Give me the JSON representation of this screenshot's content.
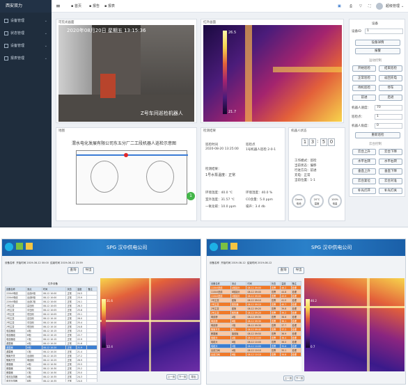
{
  "app": {
    "brand": "西安双力",
    "nav": [
      "设备管理",
      "状态管理",
      "设备管理",
      "报表管理"
    ],
    "topbar": {
      "menu_icon": "hamburger-icon",
      "crumb_home": "首页",
      "crumb_2": "报告",
      "crumb_3": "报表",
      "user": "超级管理"
    },
    "video": {
      "title": "可见光画面",
      "overlay_time": "2020年08月20日 星期五 13:15:36",
      "overlay_label": "Z号车间巡检机器人"
    },
    "thermal": {
      "title": "红外画面",
      "scale_top": "26.5",
      "scale_bottom": "21.7"
    },
    "map": {
      "title": "地图",
      "heading": "渭水电化发展有限公司东五分厂二工段机器人巡检示意图",
      "marker": "1"
    },
    "info": {
      "title": "检测结果",
      "time_label": "巡检时间",
      "time": "2020-08-20 13:25:00",
      "task_label": "巡检点",
      "task": "1号机器人巡检 2-0-1",
      "result_label": "检测结果：",
      "result": "1号水泵温度：正常",
      "readings": [
        "环境温度：40.0 ℃",
        "环境湿度：40.0 %",
        "室外温度：31.57 ℃",
        "CO含量：5.0 ppm",
        "一氧化碳：10.0 ppm",
        "噪声：3.4 db"
      ]
    },
    "status": {
      "title": "机器人状态",
      "digits": [
        "1",
        "3",
        ":",
        "5",
        "0"
      ],
      "lines": [
        "工作模式：巡检",
        "当前状态：偏移",
        "行进方向：前进",
        "充电：正常",
        "当前位置：1-1"
      ],
      "rings": [
        {
          "label": "电池",
          "val": "Check"
        },
        {
          "label": "温度",
          "val": "20°C"
        },
        {
          "label": "电量",
          "val": "100%"
        }
      ]
    },
    "control": {
      "title": "设备",
      "device_label": "设备ID",
      "device_value": "1",
      "btn_top": "设备详情",
      "btn_top2": "报警",
      "section_title": "运动控制",
      "buttons": [
        "开始巡检",
        "结束巡检",
        "正常巡检",
        "返回充电",
        "待机巡检",
        "停车",
        "前进",
        "后退"
      ],
      "speed_label": "机器人速度：",
      "speed_val": "70",
      "pos_label": "巡检点：",
      "pos_val": "1",
      "angle_label": "机器人角度：",
      "angle_val": "0",
      "reset": "重新巡检",
      "section2": "云台控制",
      "ptz": [
        "云台上升",
        "云台下降",
        "水平左转",
        "水平右转",
        "垂直上升",
        "垂直下降",
        "云台复位",
        "云台对准",
        "补光灯开",
        "补光灯关"
      ]
    }
  },
  "bottom_left": {
    "banner": "SPG 汉中供电公司",
    "filters": [
      "设备名称",
      "开始时间 2019-08-12 00:00",
      "结束时间 2019-08-12 23:59"
    ],
    "buttons": [
      "查询",
      "导出"
    ],
    "panel_title": "红外设备",
    "columns": [
      "设备名称",
      "测点",
      "时间",
      "状态",
      "温度",
      "备注"
    ],
    "rows": [
      [
        "220kV母线",
        "出线A相",
        "08-12 10:00",
        "正常",
        "24.5",
        ""
      ],
      [
        "220kV母线",
        "出线B相",
        "08-12 10:00",
        "正常",
        "23.9",
        ""
      ],
      [
        "220kV母线",
        "出线C相",
        "08-12 10:00",
        "正常",
        "24.1",
        ""
      ],
      [
        "1号主变",
        "高压侧",
        "08-12 10:05",
        "正常",
        "26.3",
        ""
      ],
      [
        "1号主变",
        "中压侧",
        "08-12 10:05",
        "正常",
        "25.8",
        ""
      ],
      [
        "1号主变",
        "低压侧",
        "08-12 10:05",
        "正常",
        "25.1",
        ""
      ],
      [
        "2号主变",
        "高压侧",
        "08-12 10:10",
        "正常",
        "26.0",
        ""
      ],
      [
        "2号主变",
        "中压侧",
        "08-12 10:10",
        "正常",
        "25.4",
        ""
      ],
      [
        "2号主变",
        "低压侧",
        "08-12 10:10",
        "正常",
        "24.8",
        ""
      ],
      [
        "电容器组",
        "A相",
        "08-12 10:15",
        "正常",
        "23.0",
        ""
      ],
      [
        "电容器组",
        "B相",
        "08-12 10:15",
        "正常",
        "22.7",
        ""
      ],
      [
        "电容器组",
        "C相",
        "08-12 10:15",
        "正常",
        "22.9",
        ""
      ],
      [
        "避雷器",
        "A相",
        "08-12 10:20",
        "正常",
        "21.6",
        ""
      ],
      [
        "避雷器",
        "B相",
        "08-12 10:20",
        "正常",
        "21.9",
        ""
      ],
      [
        "避雷器",
        "C相",
        "08-12 10:20",
        "正常",
        "21.4",
        ""
      ],
      [
        "隔离开关",
        "出线侧",
        "08-12 10:25",
        "正常",
        "27.2",
        ""
      ],
      [
        "隔离开关",
        "母线侧",
        "08-12 10:25",
        "正常",
        "26.9",
        ""
      ],
      [
        "断路器",
        "A相",
        "08-12 10:30",
        "正常",
        "25.5",
        ""
      ],
      [
        "断路器",
        "B相",
        "08-12 10:30",
        "正常",
        "25.2",
        ""
      ],
      [
        "断路器",
        "C相",
        "08-12 10:30",
        "正常",
        "25.0",
        ""
      ],
      [
        "电流互感器",
        "A相",
        "08-12 10:35",
        "正常",
        "24.3",
        ""
      ],
      [
        "电流互感器",
        "B相",
        "08-12 10:35",
        "正常",
        "24.0",
        ""
      ],
      [
        "电压互感器",
        "A相",
        "08-12 10:40",
        "正常",
        "23.6",
        ""
      ],
      [
        "电压互感器",
        "B相",
        "08-12 10:40",
        "正常",
        "23.3",
        ""
      ],
      [
        "电压互感器",
        "C相",
        "08-12 10:40",
        "正常",
        "23.1",
        ""
      ],
      [
        "站用变",
        "高压侧",
        "08-12 10:45",
        "正常",
        "22.8",
        ""
      ],
      [
        "站用变",
        "低压侧",
        "08-12 10:45",
        "正常",
        "22.4",
        ""
      ]
    ],
    "selected_row": 13,
    "scale_top": "31.6",
    "scale_bottom": "12.4",
    "foot_buttons": [
      "上一页",
      "下一页",
      "导出"
    ]
  },
  "bottom_right": {
    "banner": "SPG 汉中供电公司",
    "filters": [
      "设备名称",
      "开始时间 2019-08-12",
      "结束时间 2019-08-12"
    ],
    "buttons": [
      "查询",
      "导出"
    ],
    "columns": [
      "设备名称",
      "测点",
      "时间",
      "状态",
      "温度",
      "备注"
    ],
    "rows": [
      [
        "110kV进线",
        "A相接头",
        "08-12 09:00",
        "告警",
        "46.2",
        "处理"
      ],
      [
        "110kV进线",
        "B相接头",
        "08-12 09:00",
        "告警",
        "44.8",
        "处理"
      ],
      [
        "110kV进线",
        "C相接头",
        "08-12 09:00",
        "告警",
        "43.9",
        "处理"
      ],
      [
        "1号主变",
        "套管",
        "08-12 09:10",
        "告警",
        "41.5",
        "处理"
      ],
      [
        "1号主变",
        "散热器",
        "08-12 09:10",
        "告警",
        "40.7",
        "处理"
      ],
      [
        "2号主变",
        "套管",
        "08-12 09:20",
        "告警",
        "39.8",
        "处理"
      ],
      [
        "2号主变",
        "散热器",
        "08-12 09:20",
        "告警",
        "39.2",
        "处理"
      ],
      [
        "母线桥",
        "A相",
        "08-12 09:30",
        "告警",
        "38.6",
        "处理"
      ],
      [
        "母线桥",
        "B相",
        "08-12 09:30",
        "告警",
        "38.1",
        "处理"
      ],
      [
        "母线桥",
        "C相",
        "08-12 09:30",
        "告警",
        "37.7",
        "处理"
      ],
      [
        "隔离开关",
        "触头",
        "08-12 09:40",
        "告警",
        "37.2",
        "处理"
      ],
      [
        "断路器",
        "接线板",
        "08-12 09:50",
        "告警",
        "36.9",
        "处理"
      ],
      [
        "电缆头",
        "A相",
        "08-12 10:00",
        "告警",
        "36.4",
        "处理"
      ],
      [
        "电缆头",
        "B相",
        "08-12 10:00",
        "告警",
        "36.0",
        "处理"
      ],
      [
        "电缆头",
        "C相",
        "08-12 10:00",
        "告警",
        "35.6",
        "处理"
      ],
      [
        "出线刀闸",
        "A相",
        "08-12 10:10",
        "告警",
        "35.1",
        "处理"
      ],
      [
        "出线刀闸",
        "B相",
        "08-12 10:10",
        "告警",
        "34.8",
        "处理"
      ]
    ],
    "selected_row": 14,
    "scale_top": "46.2",
    "scale_bottom": "0.7",
    "foot_buttons": [
      "上一页",
      "下一页"
    ]
  }
}
